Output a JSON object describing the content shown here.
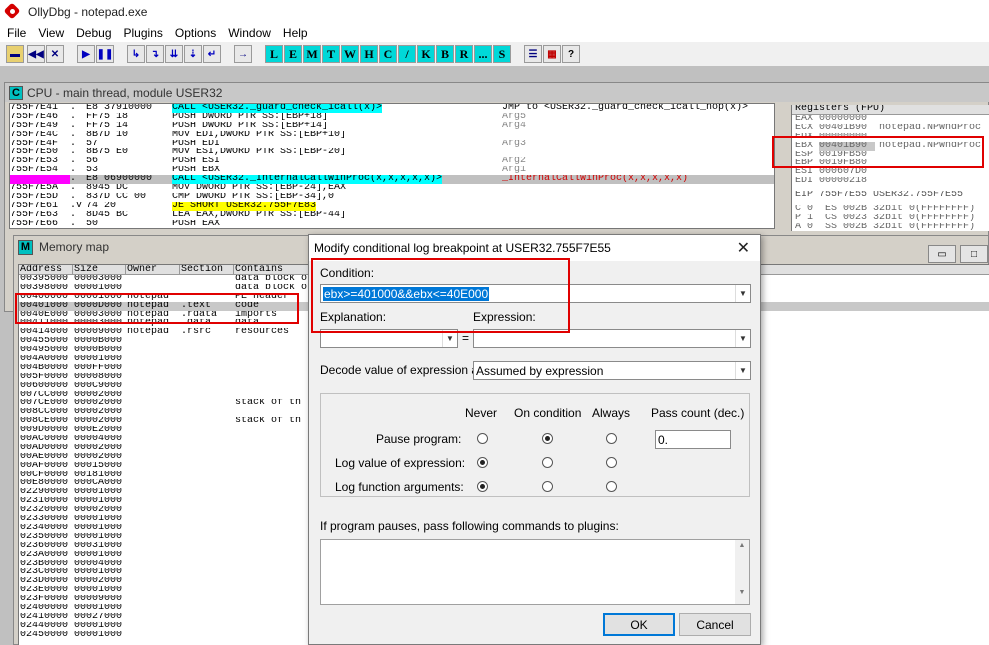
{
  "window": {
    "title": "OllyDbg - notepad.exe"
  },
  "menu": [
    "File",
    "View",
    "Debug",
    "Plugins",
    "Options",
    "Window",
    "Help"
  ],
  "toolbar": {
    "icons": [
      "open-icon",
      "restart-icon",
      "close-icon",
      "run-icon",
      "pause-icon",
      "step-into-icon",
      "step-over-icon",
      "trace-into-icon",
      "trace-over-icon",
      "execute-till-return-icon",
      "goto-icon"
    ],
    "letters": [
      "L",
      "E",
      "M",
      "T",
      "W",
      "H",
      "C",
      "/",
      "K",
      "B",
      "R",
      "...",
      "S"
    ],
    "right_icons": [
      "list-icon",
      "colors-icon",
      "help-icon"
    ],
    "help_glyph": "?"
  },
  "cpu": {
    "icon_letter": "C",
    "title": "CPU - main thread, module USER32",
    "disasm": [
      {
        "addr": "755F7E41",
        "mark": ".",
        "hex": "E8 37910000",
        "cmd": "CALL <USER32._guard_check_icall(x)>",
        "comment": "JMP to <USER32._guard_check_icall_nop(x)>"
      },
      {
        "addr": "755F7E46",
        "mark": ".",
        "hex": "FF75 18",
        "cmd": "PUSH DWORD PTR SS:[EBP+18]",
        "comment": "Arg5"
      },
      {
        "addr": "755F7E49",
        "mark": ".",
        "hex": "FF75 14",
        "cmd": "PUSH DWORD PTR SS:[EBP+14]",
        "comment": "Arg4"
      },
      {
        "addr": "755F7E4C",
        "mark": ".",
        "hex": "8B7D 10",
        "cmd": "MOV EDI,DWORD PTR SS:[EBP+10]",
        "comment": ""
      },
      {
        "addr": "755F7E4F",
        "mark": ".",
        "hex": "57",
        "cmd": "PUSH EDI",
        "comment": "Arg3"
      },
      {
        "addr": "755F7E50",
        "mark": ".",
        "hex": "8B75 E0",
        "cmd": "MOV ESI,DWORD PTR SS:[EBP-20]",
        "comment": ""
      },
      {
        "addr": "755F7E53",
        "mark": ".",
        "hex": "56",
        "cmd": "PUSH ESI",
        "comment": "Arg2"
      },
      {
        "addr": "755F7E54",
        "mark": ".",
        "hex": "53",
        "cmd": "PUSH EBX",
        "comment": "Arg1"
      },
      {
        "addr": "755F7E55",
        "mark": ".",
        "hex": "E8 06900000",
        "cmd": "CALL <USER32._InternalCallWinProc(x,x,x,x,x)>",
        "comment": "_InternalCallWinProc(x,x,x,x,x)"
      },
      {
        "addr": "755F7E5A",
        "mark": ".",
        "hex": "8945 DC",
        "cmd": "MOV DWORD PTR SS:[EBP-24],EAX",
        "comment": ""
      },
      {
        "addr": "755F7E5D",
        "mark": ".",
        "hex": "837D CC 00",
        "cmd": "CMP DWORD PTR SS:[EBP-34],0",
        "comment": ""
      },
      {
        "addr": "755F7E61",
        "mark": ".v",
        "hex": "74 20",
        "cmd": "JE SHORT USER32.755F7E83",
        "comment": ""
      },
      {
        "addr": "755F7E63",
        "mark": ".",
        "hex": "8D45 BC",
        "cmd": "LEA EAX,DWORD PTR SS:[EBP-44]",
        "comment": ""
      },
      {
        "addr": "755F7E66",
        "mark": ".",
        "hex": "50",
        "cmd": "PUSH EAX",
        "comment": ""
      }
    ],
    "registers_header": "Registers (FPU)",
    "registers": [
      {
        "name": "EAX",
        "value": "00000000",
        "note": ""
      },
      {
        "name": "ECX",
        "value": "00401B90",
        "note": "notepad.NPWndProc"
      },
      {
        "name": "EDX",
        "value": "00000000",
        "note": ""
      },
      {
        "name": "EBX",
        "value": "00401B90",
        "note": "notepad.NPWndProc"
      },
      {
        "name": "ESP",
        "value": "0019FB50",
        "note": ""
      },
      {
        "name": "EBP",
        "value": "0019FB80",
        "note": ""
      },
      {
        "name": "ESI",
        "value": "000607D0",
        "note": ""
      },
      {
        "name": "EDI",
        "value": "00000218",
        "note": ""
      }
    ],
    "eip": "EIP 755F7E55 USER32.755F7E55",
    "flags": [
      "C 0  ES 002B 32bit 0(FFFFFFFF)",
      "P 1  CS 0023 32bit 0(FFFFFFFF)",
      "A 0  SS 002B 32bit 0(FFFFFFFF)"
    ]
  },
  "memory_map": {
    "icon_letter": "M",
    "title": "Memory map",
    "controls": [
      "minimize-icon",
      "maximize-icon"
    ],
    "columns": [
      "Address",
      "Size",
      "Owner",
      "Section",
      "Contains"
    ],
    "rows": [
      [
        "00395000",
        "00003000",
        "",
        "",
        "data block o"
      ],
      [
        "00398000",
        "00001000",
        "",
        "",
        "data block o"
      ],
      [
        "00400000",
        "00001000",
        "notepad",
        "",
        "PE header"
      ],
      [
        "00401000",
        "0000D000",
        "notepad",
        ".text",
        "code"
      ],
      [
        "0040E000",
        "00003000",
        "notepad",
        ".rdata",
        "imports"
      ],
      [
        "00411000",
        "00003000",
        "notepad",
        ".data",
        "data"
      ],
      [
        "00414000",
        "00009000",
        "notepad",
        ".rsrc",
        "resources"
      ],
      [
        "00455000",
        "0000B000",
        "",
        "",
        ""
      ],
      [
        "00495000",
        "0000B000",
        "",
        "",
        ""
      ],
      [
        "004A0000",
        "00001000",
        "",
        "",
        ""
      ],
      [
        "004B0000",
        "000FF000",
        "",
        "",
        ""
      ],
      [
        "005F0000",
        "00008000",
        "",
        "",
        ""
      ],
      [
        "00600000",
        "000C9000",
        "",
        "",
        ""
      ],
      [
        "007CC000",
        "00002000",
        "",
        "",
        ""
      ],
      [
        "007CE000",
        "00002000",
        "",
        "",
        "stack of th"
      ],
      [
        "008CC000",
        "00002000",
        "",
        "",
        ""
      ],
      [
        "008CE000",
        "00002000",
        "",
        "",
        "stack of th"
      ],
      [
        "009D0000",
        "000E2000",
        "",
        "",
        ""
      ],
      [
        "00AC0000",
        "00004000",
        "",
        "",
        ""
      ],
      [
        "00AD0000",
        "00002000",
        "",
        "",
        ""
      ],
      [
        "00AE0000",
        "00002000",
        "",
        "",
        ""
      ],
      [
        "00AF0000",
        "00015000",
        "",
        "",
        ""
      ],
      [
        "00CF0000",
        "00181000",
        "",
        "",
        ""
      ],
      [
        "00E80000",
        "000CA000",
        "",
        "",
        ""
      ],
      [
        "02290000",
        "00001000",
        "",
        "",
        ""
      ],
      [
        "02310000",
        "00001000",
        "",
        "",
        ""
      ],
      [
        "02320000",
        "00002000",
        "",
        "",
        ""
      ],
      [
        "02330000",
        "00001000",
        "",
        "",
        ""
      ],
      [
        "02340000",
        "00001000",
        "",
        "",
        ""
      ],
      [
        "02350000",
        "00001000",
        "",
        "",
        ""
      ],
      [
        "02360000",
        "00031000",
        "",
        "",
        ""
      ],
      [
        "023A0000",
        "00001000",
        "",
        "",
        ""
      ],
      [
        "023B0000",
        "00004000",
        "",
        "",
        ""
      ],
      [
        "023C0000",
        "00001000",
        "",
        "",
        ""
      ],
      [
        "023D0000",
        "00002000",
        "",
        "",
        ""
      ],
      [
        "023E0000",
        "00001000",
        "",
        "",
        ""
      ],
      [
        "023F0000",
        "00009000",
        "",
        "",
        ""
      ],
      [
        "02400000",
        "00001000",
        "",
        "",
        ""
      ],
      [
        "02410000",
        "00027000",
        "",
        "",
        ""
      ],
      [
        "02440000",
        "00001000",
        "",
        "",
        ""
      ],
      [
        "02450000",
        "00001000",
        "",
        "",
        ""
      ]
    ]
  },
  "dialog": {
    "title": "Modify conditional log breakpoint at USER32.755F7E55",
    "close_glyph": "✕",
    "condition_label": "Condition:",
    "condition_value": "ebx>=401000&&ebx<=40E000",
    "explanation_label": "Explanation:",
    "explanation_value": "",
    "eq": "=",
    "expression_label": "Expression:",
    "expression_value": "",
    "decode_label": "Decode value of expression as:",
    "decode_value": "Assumed by expression",
    "columns": [
      "Never",
      "On condition",
      "Always",
      "Pass count (dec.)"
    ],
    "rows": [
      {
        "label": "Pause program:",
        "selected": 1
      },
      {
        "label": "Log value of expression:",
        "selected": 0
      },
      {
        "label": "Log function arguments:",
        "selected": 0
      }
    ],
    "pass_count": "0.",
    "plugins_label": "If program pauses, pass following commands to plugins:",
    "plugins_value": "",
    "ok": "OK",
    "cancel": "Cancel"
  },
  "colors": {
    "highlight_red": "#e00000",
    "cyan": "#00ffff",
    "selection": "#0078d7",
    "eip_row": "#c0c0c0"
  }
}
